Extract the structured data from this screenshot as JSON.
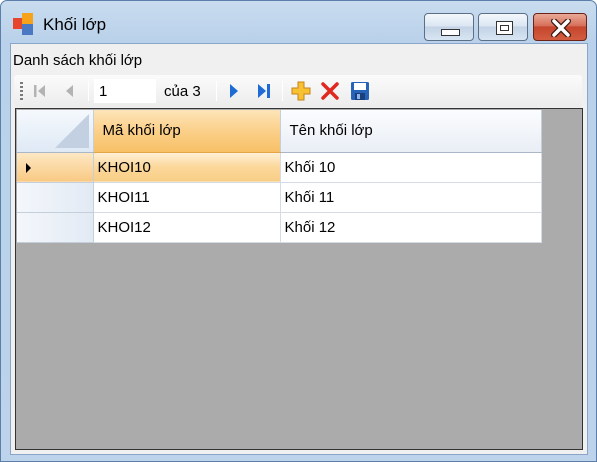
{
  "window": {
    "title": "Khối lớp",
    "controls": {
      "minimize": "minimize-icon",
      "maximize": "maximize-icon",
      "close": "close-icon"
    }
  },
  "group": {
    "label": "Danh sách khối lớp"
  },
  "navigator": {
    "position": "1",
    "count_label": "của 3",
    "icons": [
      "move-first-icon",
      "move-previous-icon",
      "move-next-icon",
      "move-last-icon",
      "add-icon",
      "delete-icon",
      "save-icon"
    ]
  },
  "grid": {
    "columns": [
      "Mã khối lớp",
      "Tên khối lớp"
    ],
    "rows": [
      {
        "ma": "KHOI10",
        "ten": "Khối 10"
      },
      {
        "ma": "KHOI11",
        "ten": "Khối 11"
      },
      {
        "ma": "KHOI12",
        "ten": "Khối 12"
      }
    ],
    "current_row": 0
  },
  "colors": {
    "selection": "#f9c983",
    "title_bar": "#c9dcef",
    "close_button": "#c5452d",
    "nav_arrow": "#1e6bd6"
  }
}
